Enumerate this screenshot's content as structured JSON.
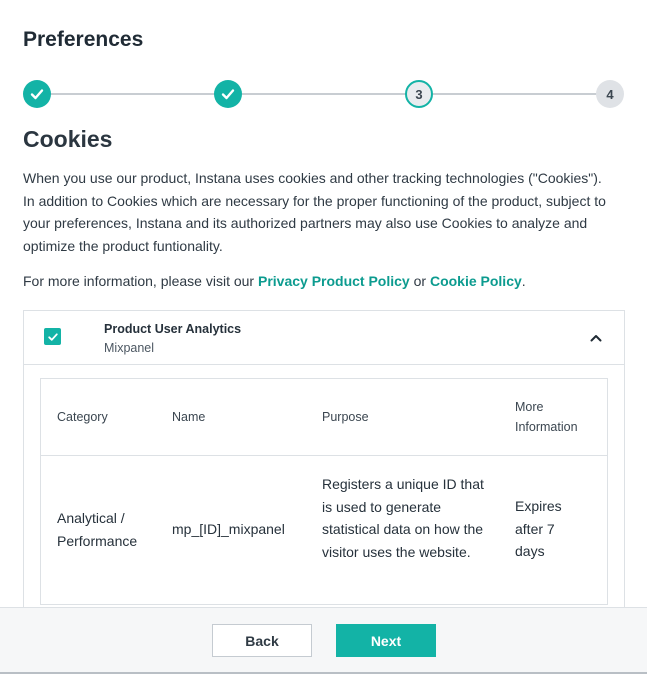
{
  "header": {
    "title": "Preferences"
  },
  "stepper": {
    "steps": [
      {
        "state": "done",
        "label": ""
      },
      {
        "state": "done",
        "label": ""
      },
      {
        "state": "active",
        "label": "3"
      },
      {
        "state": "pending",
        "label": "4"
      }
    ],
    "accent": "#13b3a6"
  },
  "section": {
    "heading": "Cookies",
    "description": "When you use our product, Instana uses cookies and other tracking technologies (\"Cookies\"). In addition to Cookies which are necessary for the proper functioning of the product, subject to your preferences, Instana and its authorized partners may also use Cookies to analyze and optimize the product funtionality.",
    "info_prefix": "For more information, please visit our ",
    "privacy_link": "Privacy Product Policy",
    "info_or": " or ",
    "cookie_link": "Cookie Policy",
    "info_suffix": "."
  },
  "panel": {
    "checked": true,
    "title": "Product User Analytics",
    "subtitle": "Mixpanel",
    "expanded": true,
    "table": {
      "columns": [
        "Category",
        "Name",
        "Purpose",
        "More Information"
      ],
      "rows": [
        {
          "category": "Analytical / Performance",
          "name": "mp_[ID]_mixpanel",
          "purpose": "Registers a unique ID that is used to generate statistical data on how the visitor uses the website.",
          "more_info": "Expires after 7 days"
        }
      ]
    }
  },
  "footer": {
    "back_label": "Back",
    "next_label": "Next"
  },
  "colors": {
    "accent": "#13b3a6",
    "link": "#0c9b8f",
    "border": "#dde1e5"
  },
  "icons": [
    "check-icon",
    "chevron-up-icon"
  ]
}
